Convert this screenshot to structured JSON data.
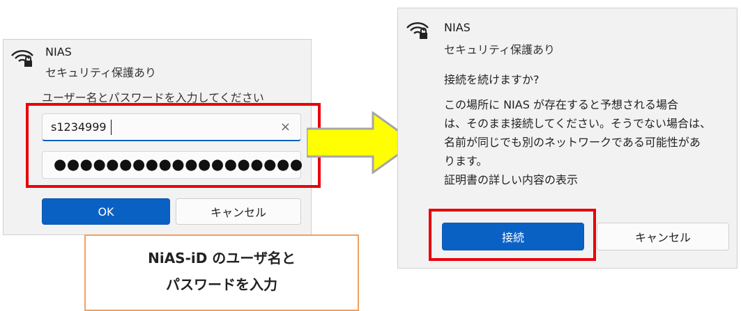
{
  "left_dialog": {
    "network_name": "NIAS",
    "security_status": "セキュリティ保護あり",
    "prompt": "ユーザー名とパスワードを入力してください",
    "username_value": "s1234999",
    "password_mask": "●●●●●●●●●●●●●●●●●●●",
    "clear_glyph": "×",
    "ok_label": "OK",
    "cancel_label": "キャンセル"
  },
  "callout": {
    "line1": "NiAS-iD のユーザ名と",
    "line2": "パスワードを入力"
  },
  "right_dialog": {
    "network_name": "NIAS",
    "security_status": "セキュリティ保護あり",
    "question": "接続を続けますか?",
    "message_lines": [
      "この場所に NIAS が存在すると予想される場合",
      "は、そのまま接続してください。そうでない場合は、",
      "名前が同じでも別のネットワークである可能性があ",
      "ります。"
    ],
    "details_link": "証明書の詳しい内容の表示",
    "connect_label": "接続",
    "cancel_label": "キャンセル"
  },
  "colors": {
    "highlight_red": "#e8000a",
    "arrow_yellow": "#ffff00",
    "primary_blue": "#0a61c4",
    "callout_border": "#f0a060"
  },
  "icons": [
    "wifi-secure-icon",
    "clear-icon",
    "arrow-right-icon"
  ]
}
